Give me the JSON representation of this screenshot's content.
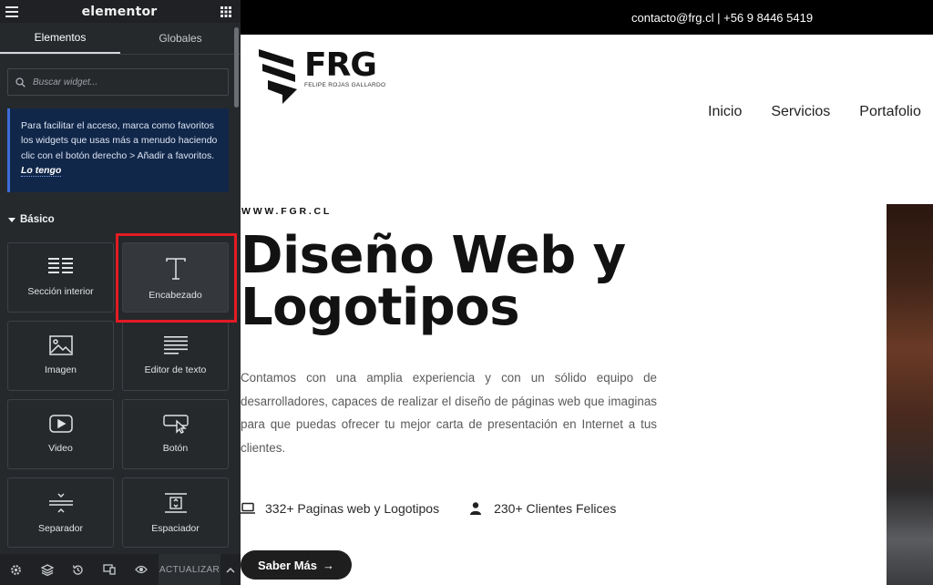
{
  "panel": {
    "brand": "elementor",
    "tabs": [
      {
        "label": "Elementos",
        "active": true
      },
      {
        "label": "Globales",
        "active": false
      }
    ],
    "search": {
      "placeholder": "Buscar widget..."
    },
    "notice": {
      "text": "Para facilitar el acceso, marca como favoritos los widgets que usas más a menudo haciendo clic con el botón derecho > Añadir a favoritos.",
      "link": "Lo tengo"
    },
    "section_title": "Básico",
    "widgets": [
      {
        "label": "Sección interior",
        "icon": "inner-section-icon"
      },
      {
        "label": "Encabezado",
        "icon": "heading-icon",
        "highlighted": true
      },
      {
        "label": "Imagen",
        "icon": "image-icon"
      },
      {
        "label": "Editor de texto",
        "icon": "text-editor-icon"
      },
      {
        "label": "Video",
        "icon": "video-icon"
      },
      {
        "label": "Botón",
        "icon": "button-icon"
      },
      {
        "label": "Separador",
        "icon": "divider-icon"
      },
      {
        "label": "Espaciador",
        "icon": "spacer-icon"
      }
    ],
    "footer": {
      "icons": [
        "settings-icon",
        "navigator-icon",
        "history-icon",
        "responsive-icon",
        "preview-icon"
      ],
      "update_label": "ACTUALIZAR"
    },
    "highlight_color": "#e31b23"
  },
  "site": {
    "topbar": "contacto@frg.cl | +56 9 8446 5419",
    "logo": {
      "main": "FRG",
      "sub": "FELIPE ROJAS GALLARDO"
    },
    "nav": [
      "Inicio",
      "Servicios",
      "Portafolio"
    ],
    "eyebrow": "WWW.FGR.CL",
    "hero_title_line1": "Diseño Web y",
    "hero_title_line2": "Logotipos",
    "hero_text": "Contamos con una amplia experiencia y con un sólido equipo de desarrolladores, capaces de realizar el diseño de páginas web que imaginas para que puedas ofrecer tu mejor carta de presentación en Internet a tus clientes.",
    "stats": [
      {
        "icon": "laptop-icon",
        "label": "332+ Paginas web y Logotipos"
      },
      {
        "icon": "user-icon",
        "label": "230+ Clientes Felices"
      }
    ],
    "cta": "Saber Más",
    "cta_arrow": "→"
  }
}
